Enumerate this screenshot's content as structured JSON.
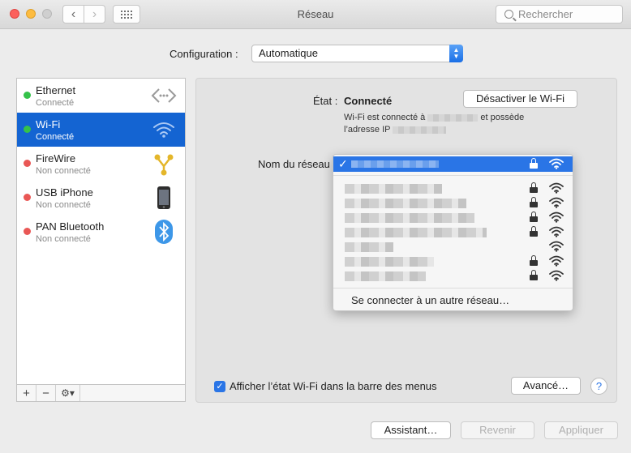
{
  "window": {
    "title": "Réseau"
  },
  "toolbar": {
    "back": "‹",
    "forward": "›",
    "search_placeholder": "Rechercher"
  },
  "configuration": {
    "label": "Configuration :",
    "value": "Automatique"
  },
  "services": [
    {
      "name": "Ethernet",
      "status": "Connecté",
      "status_color": "#35c24a",
      "icon": "ethernet-arrows-icon",
      "selected": false
    },
    {
      "name": "Wi-Fi",
      "status": "Connecté",
      "status_color": "#35c24a",
      "icon": "wifi-icon",
      "selected": true
    },
    {
      "name": "FireWire",
      "status": "Non connecté",
      "status_color": "#e95755",
      "icon": "firewire-icon",
      "selected": false
    },
    {
      "name": "USB iPhone",
      "status": "Non connecté",
      "status_color": "#e95755",
      "icon": "iphone-icon",
      "selected": false
    },
    {
      "name": "PAN Bluetooth",
      "status": "Non connecté",
      "status_color": "#e95755",
      "icon": "bluetooth-icon",
      "selected": false
    }
  ],
  "sidebar_controls": {
    "add": "+",
    "remove": "−",
    "action": "⚙▾"
  },
  "detail": {
    "state_label": "État :",
    "state_value": "Connecté",
    "toggle_button": "Désactiver le Wi-Fi",
    "desc_line1_start": "Wi-Fi est connecté à",
    "desc_line1_end": "et possède",
    "desc_line2_start": "l’adresse IP",
    "network_label": "Nom du réseau",
    "other_network": "Se connecter à un autre réseau…",
    "show_status_label": "Afficher l’état Wi-Fi dans la barre des menus",
    "show_status_checked": true,
    "advanced_button": "Avancé…",
    "help": "?"
  },
  "networks": [
    {
      "locked": true
    },
    {
      "locked": true
    },
    {
      "locked": true
    },
    {
      "locked": true
    },
    {
      "locked": false
    },
    {
      "locked": true
    },
    {
      "locked": true
    }
  ],
  "footer": {
    "assistant": "Assistant…",
    "revert": "Revenir",
    "apply": "Appliquer"
  },
  "colors": {
    "accent": "#2a75e6",
    "selection": "#1464d2"
  }
}
